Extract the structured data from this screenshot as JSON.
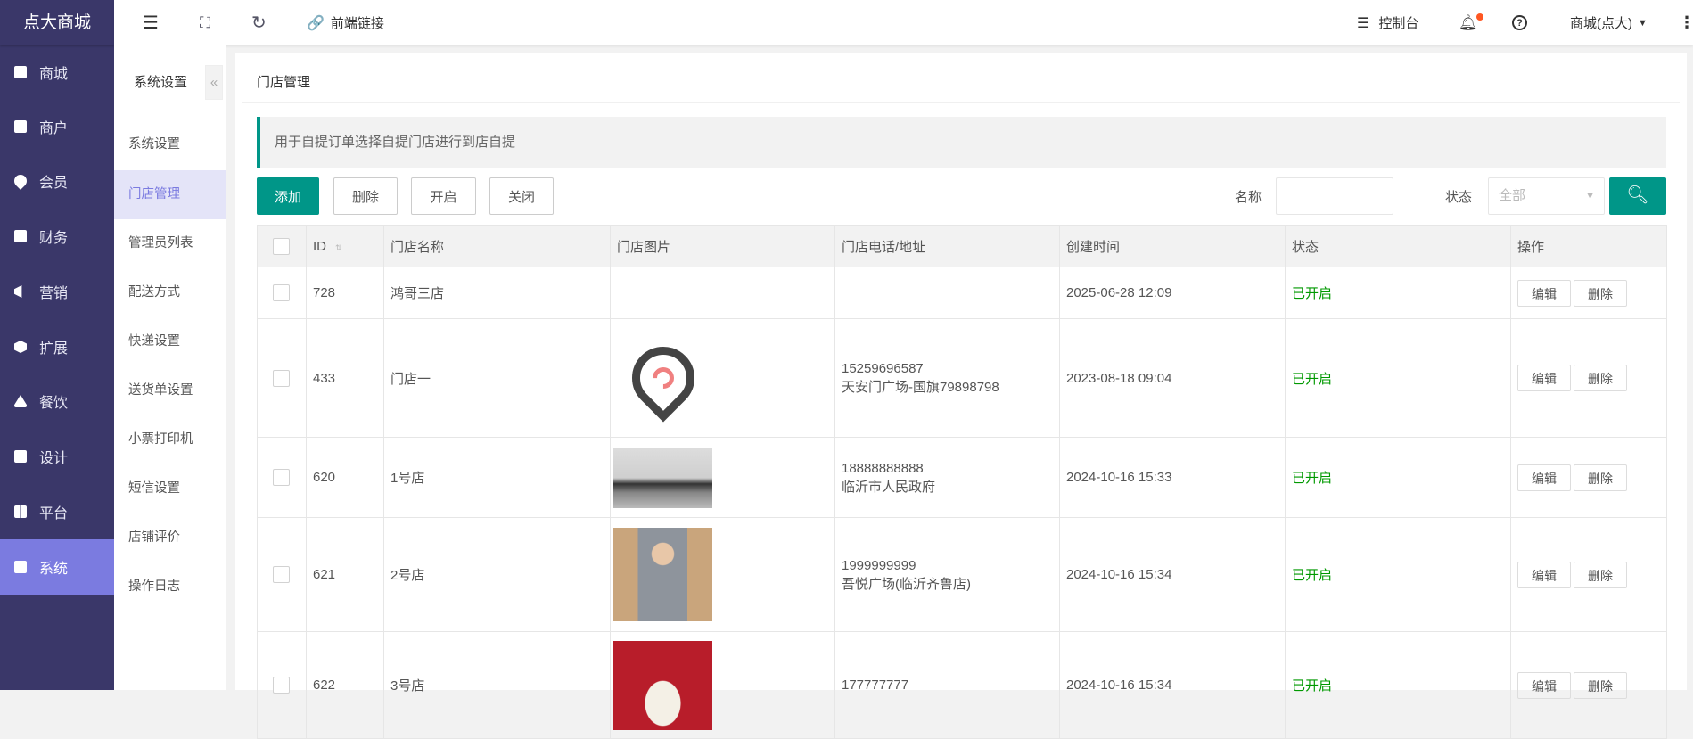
{
  "brand": "点大商城",
  "nav": [
    {
      "label": "商城"
    },
    {
      "label": "商户"
    },
    {
      "label": "会员"
    },
    {
      "label": "财务"
    },
    {
      "label": "营销"
    },
    {
      "label": "扩展"
    },
    {
      "label": "餐饮"
    },
    {
      "label": "设计"
    },
    {
      "label": "平台"
    },
    {
      "label": "系统"
    }
  ],
  "topbar": {
    "frontend_link": "前端链接",
    "console": "控制台",
    "shop_switch": "商城(点大)"
  },
  "submenu": {
    "title": "系统设置",
    "items": [
      "系统设置",
      "门店管理",
      "管理员列表",
      "配送方式",
      "快递设置",
      "送货单设置",
      "小票打印机",
      "短信设置",
      "店铺评价",
      "操作日志"
    ]
  },
  "page": {
    "title": "门店管理",
    "notice": "用于自提订单选择自提门店进行到店自提"
  },
  "toolbar": {
    "add": "添加",
    "delete": "删除",
    "enable": "开启",
    "disable": "关闭",
    "name_label": "名称",
    "name_value": "",
    "status_label": "状态",
    "status_value": "全部"
  },
  "table": {
    "headers": [
      "ID",
      "门店名称",
      "门店图片",
      "门店电话/地址",
      "创建时间",
      "状态",
      "操作"
    ],
    "edit": "编辑",
    "delete": "删除",
    "rows": [
      {
        "id": "728",
        "name": "鸿哥三店",
        "phone": "",
        "address": "",
        "created": "2025-06-28 12:09",
        "status": "已开启"
      },
      {
        "id": "433",
        "name": "门店一",
        "phone": "15259696587",
        "address": "天安门广场-国旗79898798",
        "created": "2023-08-18 09:04",
        "status": "已开启"
      },
      {
        "id": "620",
        "name": "1号店",
        "phone": "18888888888",
        "address": "临沂市人民政府",
        "created": "2024-10-16 15:33",
        "status": "已开启"
      },
      {
        "id": "621",
        "name": "2号店",
        "phone": "1999999999",
        "address": "吾悦广场(临沂齐鲁店)",
        "created": "2024-10-16 15:34",
        "status": "已开启"
      },
      {
        "id": "622",
        "name": "3号店",
        "phone": "177777777",
        "address": "",
        "created": "2024-10-16 15:34",
        "status": "已开启"
      }
    ]
  },
  "colors": {
    "nav_bg": "#3a3769",
    "nav_active": "#7b7be0",
    "primary": "#009688",
    "status_on": "#009900"
  }
}
